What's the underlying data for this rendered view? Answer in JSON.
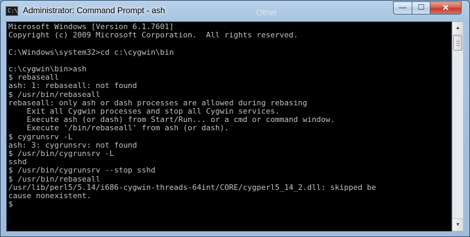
{
  "window": {
    "title": "Administrator: Command Prompt - ash",
    "icon_label": "C:\\"
  },
  "background": {
    "ghost_text": "Other"
  },
  "controls": {
    "minimize_glyph": "—",
    "maximize_glyph": "☐",
    "close_glyph": "✕"
  },
  "scrollbar": {
    "up_glyph": "▲",
    "down_glyph": "▼"
  },
  "console": {
    "lines": [
      "Microsoft Windows [Version 6.1.7601]",
      "Copyright (c) 2009 Microsoft Corporation.  All rights reserved.",
      "",
      "C:\\Windows\\system32>cd c:\\cygwin\\bin",
      "",
      "c:\\cygwin\\bin>ash",
      "$ rebaseall",
      "ash: 1: rebaseall: not found",
      "$ /usr/bin/rebaseall",
      "rebaseall: only ash or dash processes are allowed during rebasing",
      "    Exit all Cygwin processes and stop all Cygwin services.",
      "    Execute ash (or dash) from Start/Run... or a cmd or command window.",
      "    Execute '/bin/rebaseall' from ash (or dash).",
      "$ cygrunsrv -L",
      "ash: 3: cygrunsrv: not found",
      "$ /usr/bin/cygrunsrv -L",
      "sshd",
      "$ /usr/bin/cygrunsrv --stop sshd",
      "$ /usr/bin/rebaseall",
      "/usr/lib/perl5/5.14/i686-cygwin-threads-64int/CORE/cygperl5_14_2.dll: skipped be",
      "cause nonexistent.",
      "$"
    ]
  }
}
